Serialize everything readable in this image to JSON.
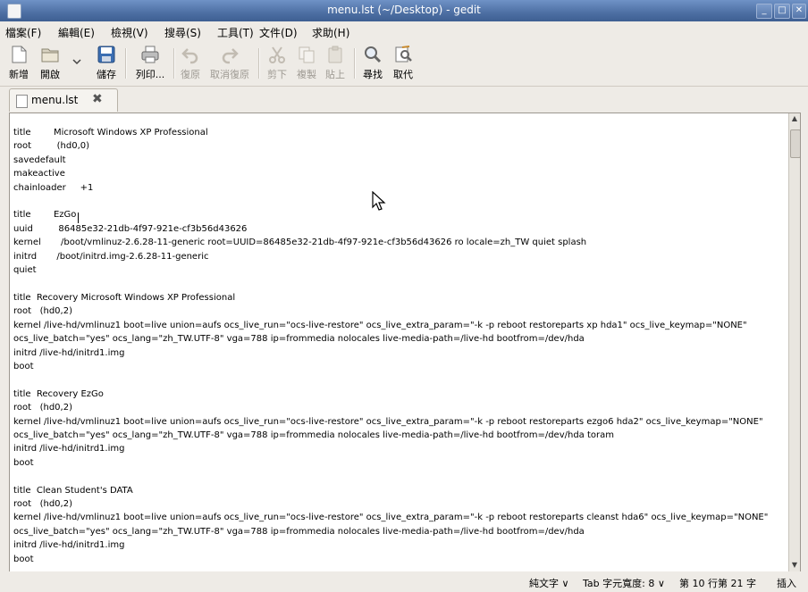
{
  "window": {
    "title": "menu.lst (~/Desktop) - gedit",
    "min_label": "_",
    "max_label": "□",
    "close_label": "✕"
  },
  "menu": {
    "items": [
      "檔案(F)",
      "編輯(E)",
      "檢視(V)",
      "搜尋(S)",
      "工具(T)",
      "文件(D)",
      "求助(H)"
    ]
  },
  "toolbar": {
    "new": "新增",
    "open": "開啟",
    "save": "儲存",
    "print": "列印...",
    "undo": "復原",
    "redo": "取消復原",
    "cut": "剪下",
    "copy": "複製",
    "paste": "貼上",
    "find": "尋找",
    "replace": "取代"
  },
  "tab": {
    "filename": "menu.lst",
    "close_glyph": "✖"
  },
  "document": {
    "lines": [
      "title        Microsoft Windows XP Professional",
      "root         (hd0,0)",
      "savedefault",
      "makeactive",
      "chainloader     +1",
      "",
      "title        EzGo",
      "uuid         86485e32-21db-4f97-921e-cf3b56d43626",
      "kernel       /boot/vmlinuz-2.6.28-11-generic root=UUID=86485e32-21db-4f97-921e-cf3b56d43626 ro locale=zh_TW quiet splash",
      "initrd       /boot/initrd.img-2.6.28-11-generic",
      "quiet",
      "",
      "title  Recovery Microsoft Windows XP Professional",
      "root   (hd0,2)",
      "kernel /live-hd/vmlinuz1 boot=live union=aufs ocs_live_run=\"ocs-live-restore\" ocs_live_extra_param=\"-k -p reboot restoreparts xp hda1\" ocs_live_keymap=\"NONE\"",
      "ocs_live_batch=\"yes\" ocs_lang=\"zh_TW.UTF-8\" vga=788 ip=frommedia nolocales live-media-path=/live-hd bootfrom=/dev/hda",
      "initrd /live-hd/initrd1.img",
      "boot",
      "",
      "title  Recovery EzGo",
      "root   (hd0,2)",
      "kernel /live-hd/vmlinuz1 boot=live union=aufs ocs_live_run=\"ocs-live-restore\" ocs_live_extra_param=\"-k -p reboot restoreparts ezgo6 hda2\" ocs_live_keymap=\"NONE\"",
      "ocs_live_batch=\"yes\" ocs_lang=\"zh_TW.UTF-8\" vga=788 ip=frommedia nolocales live-media-path=/live-hd bootfrom=/dev/hda toram",
      "initrd /live-hd/initrd1.img",
      "boot",
      "",
      "title  Clean Student's DATA",
      "root   (hd0,2)",
      "kernel /live-hd/vmlinuz1 boot=live union=aufs ocs_live_run=\"ocs-live-restore\" ocs_live_extra_param=\"-k -p reboot restoreparts cleanst hda6\" ocs_live_keymap=\"NONE\"",
      "ocs_live_batch=\"yes\" ocs_lang=\"zh_TW.UTF-8\" vga=788 ip=frommedia nolocales live-media-path=/live-hd bootfrom=/dev/hda",
      "initrd /live-hd/initrd1.img",
      "boot"
    ]
  },
  "status": {
    "mode": "純文字 ∨",
    "tab_width": "Tab 字元寬度: 8 ∨",
    "position": "第 10 行第 21 字",
    "insert": "插入"
  },
  "colors": {
    "titlebar": "#4d6fa3",
    "chrome": "#eeebe6",
    "editor_bg": "#ffffff"
  }
}
